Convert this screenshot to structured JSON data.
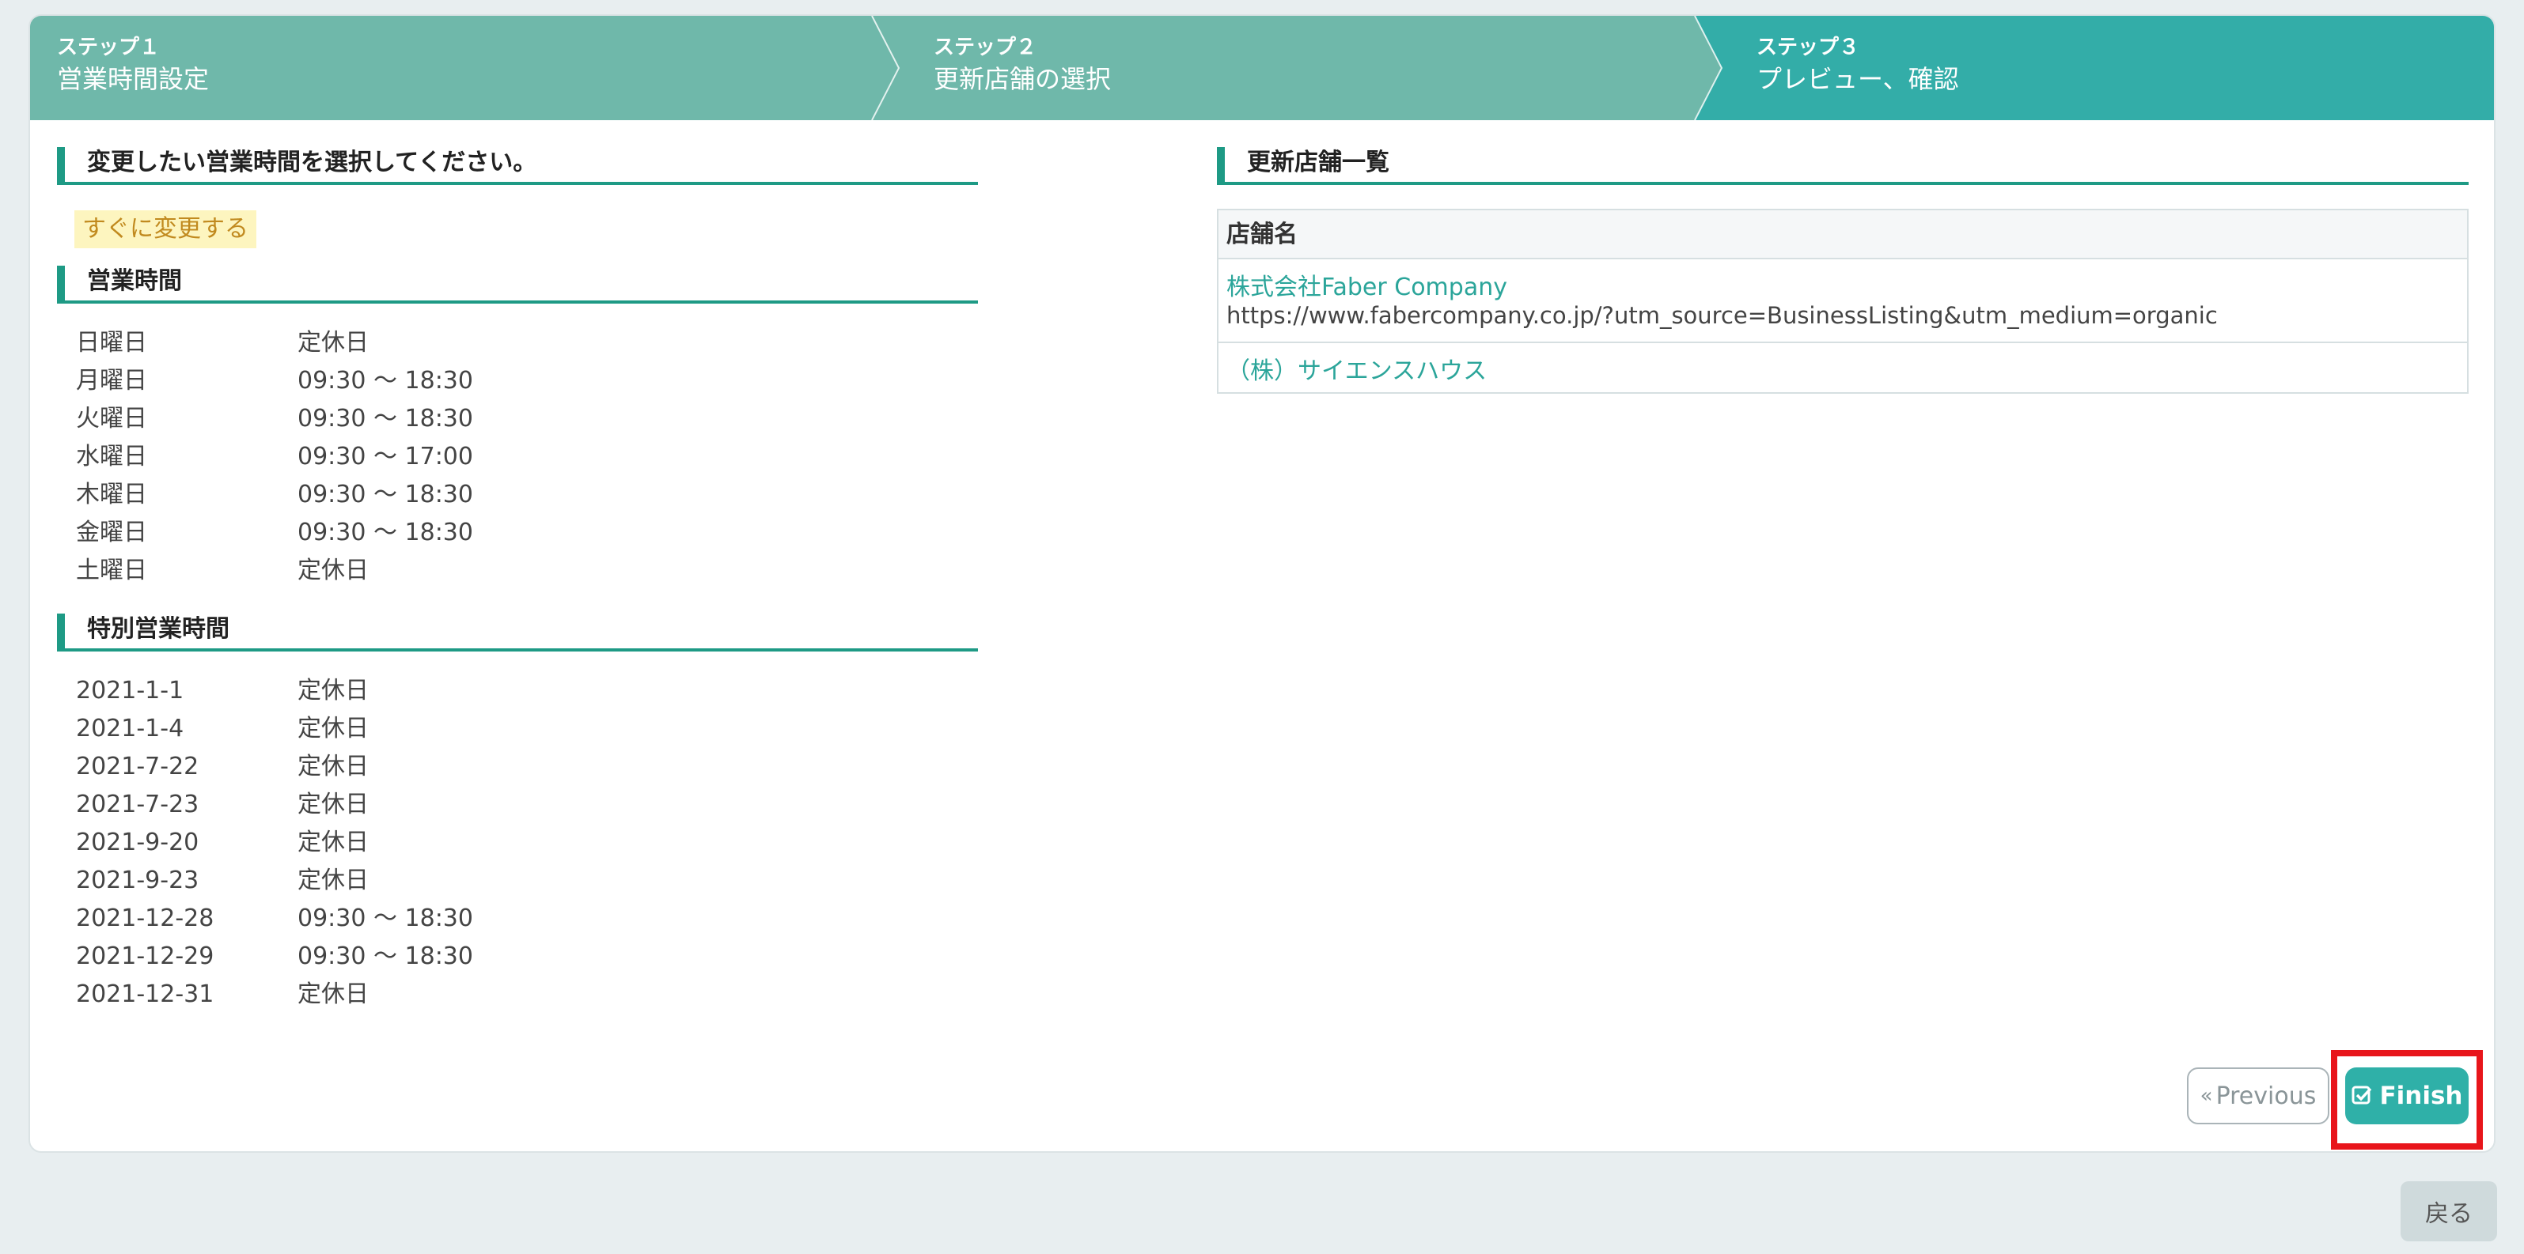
{
  "wizard": {
    "steps": [
      {
        "num": "ステップ１",
        "title": "営業時間設定"
      },
      {
        "num": "ステップ２",
        "title": "更新店舗の選択"
      },
      {
        "num": "ステップ３",
        "title": "プレビュー、確認"
      }
    ],
    "colors": {
      "done": "#6fb8aa",
      "active": "#33ada8"
    }
  },
  "left": {
    "heading": "変更したい営業時間を選択してください。",
    "timing_tag": "すぐに変更する",
    "hours_heading": "営業時間",
    "hours": [
      {
        "day": "日曜日",
        "value": "定休日"
      },
      {
        "day": "月曜日",
        "value": "09:30 ～ 18:30"
      },
      {
        "day": "火曜日",
        "value": "09:30 ～ 18:30"
      },
      {
        "day": "水曜日",
        "value": "09:30 ～ 17:00"
      },
      {
        "day": "木曜日",
        "value": "09:30 ～ 18:30"
      },
      {
        "day": "金曜日",
        "value": "09:30 ～ 18:30"
      },
      {
        "day": "土曜日",
        "value": "定休日"
      }
    ],
    "special_heading": "特別営業時間",
    "special": [
      {
        "date": "2021-1-1",
        "value": "定休日"
      },
      {
        "date": "2021-1-4",
        "value": "定休日"
      },
      {
        "date": "2021-7-22",
        "value": "定休日"
      },
      {
        "date": "2021-7-23",
        "value": "定休日"
      },
      {
        "date": "2021-9-20",
        "value": "定休日"
      },
      {
        "date": "2021-9-23",
        "value": "定休日"
      },
      {
        "date": "2021-12-28",
        "value": "09:30 ～ 18:30"
      },
      {
        "date": "2021-12-29",
        "value": "09:30 ～ 18:30"
      },
      {
        "date": "2021-12-31",
        "value": "定休日"
      }
    ]
  },
  "right": {
    "heading": "更新店舗一覧",
    "table_header": "店舗名",
    "stores": [
      {
        "name": "株式会社Faber Company",
        "url": "https://www.fabercompany.co.jp/?utm_source=BusinessListing&utm_medium=organic"
      },
      {
        "name": "（株）サイエンスハウス",
        "url": ""
      }
    ]
  },
  "buttons": {
    "previous": "Previous",
    "finish": "Finish",
    "back": "戻る"
  },
  "icons": {
    "previous": "double-chevron-left-icon",
    "finish": "check-square-icon"
  }
}
